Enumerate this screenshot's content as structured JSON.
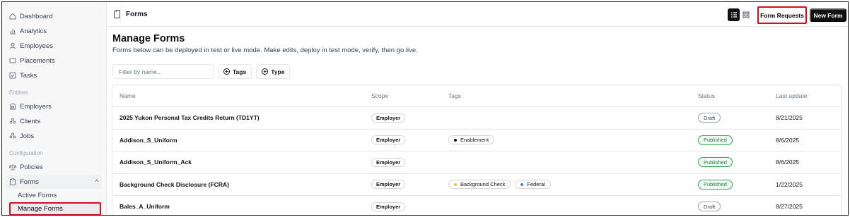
{
  "sidebar": {
    "items": [
      {
        "label": "Dashboard",
        "icon": "home-icon"
      },
      {
        "label": "Analytics",
        "icon": "bar-chart-icon"
      },
      {
        "label": "Employees",
        "icon": "user-icon"
      },
      {
        "label": "Placements",
        "icon": "placement-icon"
      },
      {
        "label": "Tasks",
        "icon": "check-square-icon"
      }
    ],
    "entities_label": "Entities",
    "entities": [
      {
        "label": "Employers",
        "icon": "building-icon"
      },
      {
        "label": "Clients",
        "icon": "users-icon"
      },
      {
        "label": "Jobs",
        "icon": "users-icon"
      }
    ],
    "config_label": "Configuration",
    "config": [
      {
        "label": "Policies",
        "icon": "scale-icon"
      }
    ],
    "forms_group": {
      "label": "Forms",
      "expanded_glyph": "^"
    },
    "forms_sub": [
      {
        "label": "Active Forms",
        "active": false
      },
      {
        "label": "Manage Forms",
        "active": true
      }
    ]
  },
  "topbar": {
    "title": "Forms",
    "form_requests_label": "Form Requests",
    "new_form_label": "New Form"
  },
  "page": {
    "title": "Manage Forms",
    "description": "Forms below can be deployed in test or live mode. Make edits, deploy in test mode, verify, then go live."
  },
  "filters": {
    "placeholder": "Filter by name...",
    "tags_label": "Tags",
    "type_label": "Type"
  },
  "table": {
    "headers": {
      "name": "Name",
      "scope": "Scope",
      "tags": "Tags",
      "status": "Status",
      "updated": "Last update"
    },
    "rows": [
      {
        "name": "2025 Yukon Personal Tax Credits Return (TD1YT)",
        "scope": "Employer",
        "tags": [],
        "status": "Draft",
        "updated": "8/21/2025"
      },
      {
        "name": "Addison_S_Uniform",
        "scope": "Employer",
        "tags": [
          {
            "label": "Enablement",
            "color": "#111111"
          }
        ],
        "status": "Published",
        "updated": "8/6/2025"
      },
      {
        "name": "Addison_S_Uniform_Ack",
        "scope": "Employer",
        "tags": [],
        "status": "Published",
        "updated": "8/6/2025"
      },
      {
        "name": "Background Check Disclosure (FCRA)",
        "scope": "Employer",
        "tags": [
          {
            "label": "Background Check",
            "color": "#f5c518"
          },
          {
            "label": "Federal",
            "color": "#3b82f6"
          }
        ],
        "status": "Published",
        "updated": "1/22/2025"
      },
      {
        "name": "Bales_A_Uniform",
        "scope": "Employer",
        "tags": [],
        "status": "Draft",
        "updated": "8/27/2025"
      }
    ]
  },
  "colors": {
    "highlight_border": "#d0101c",
    "published_green": "#34a853",
    "primary_black": "#111111"
  }
}
